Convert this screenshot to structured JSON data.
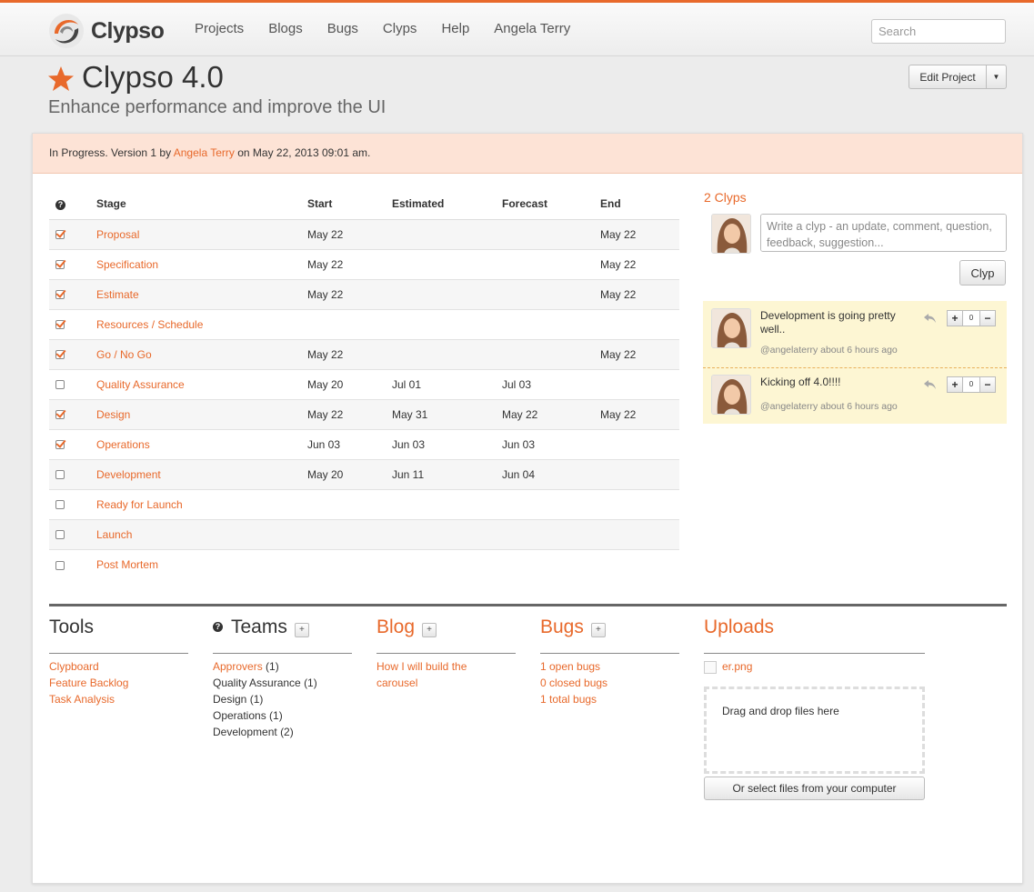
{
  "app": {
    "name": "Clypso"
  },
  "nav": {
    "items": [
      "Projects",
      "Blogs",
      "Bugs",
      "Clyps",
      "Help",
      "Angela Terry"
    ],
    "search_placeholder": "Search"
  },
  "project": {
    "title": "Clypso 4.0",
    "subtitle": "Enhance performance and improve the UI",
    "edit_label": "Edit Project"
  },
  "status": {
    "prefix": "In Progress. Version 1 by",
    "author": "Angela Terry",
    "suffix": "on May 22, 2013 09:01 am."
  },
  "stages": {
    "headers": [
      "Stage",
      "Start",
      "Estimated",
      "Forecast",
      "End"
    ],
    "rows": [
      {
        "done": true,
        "name": "Proposal",
        "start": "May 22",
        "estimated": "",
        "forecast": "",
        "end": "May 22"
      },
      {
        "done": true,
        "name": "Specification",
        "start": "May 22",
        "estimated": "",
        "forecast": "",
        "end": "May 22"
      },
      {
        "done": true,
        "name": "Estimate",
        "start": "May 22",
        "estimated": "",
        "forecast": "",
        "end": "May 22"
      },
      {
        "done": true,
        "name": "Resources / Schedule",
        "start": "",
        "estimated": "",
        "forecast": "",
        "end": ""
      },
      {
        "done": true,
        "name": "Go / No Go",
        "start": "May 22",
        "estimated": "",
        "forecast": "",
        "end": "May 22"
      },
      {
        "done": false,
        "name": "Quality Assurance",
        "start": "May 20",
        "estimated": "Jul 01",
        "forecast": "Jul 03",
        "end": ""
      },
      {
        "done": true,
        "name": "Design",
        "start": "May 22",
        "estimated": "May 31",
        "forecast": "May 22",
        "end": "May 22"
      },
      {
        "done": true,
        "name": "Operations",
        "start": "Jun 03",
        "estimated": "Jun 03",
        "forecast": "Jun 03",
        "end": ""
      },
      {
        "done": false,
        "name": "Development",
        "start": "May 20",
        "estimated": "Jun 11",
        "forecast": "Jun 04",
        "end": ""
      },
      {
        "done": false,
        "name": "Ready for Launch",
        "start": "",
        "estimated": "",
        "forecast": "",
        "end": ""
      },
      {
        "done": false,
        "name": "Launch",
        "start": "",
        "estimated": "",
        "forecast": "",
        "end": ""
      },
      {
        "done": false,
        "name": "Post Mortem",
        "start": "",
        "estimated": "",
        "forecast": "",
        "end": ""
      }
    ]
  },
  "clyps": {
    "title": "2 Clyps",
    "placeholder": "Write a clyp - an update, comment, question, feedback, suggestion...",
    "button": "Clyp",
    "items": [
      {
        "text": "Development is going pretty well..",
        "meta": "@angelaterry about 6 hours ago",
        "votes": "0"
      },
      {
        "text": "Kicking off 4.0!!!!",
        "meta": "@angelaterry about 6 hours ago",
        "votes": "0"
      }
    ]
  },
  "tools": {
    "title": "Tools",
    "items": [
      "Clypboard",
      "Feature Backlog",
      "Task Analysis"
    ]
  },
  "teams": {
    "title": "Teams",
    "items": [
      {
        "name": "Approvers",
        "count": "(1)"
      },
      {
        "name": "Quality Assurance",
        "count": "(1)"
      },
      {
        "name": "Design",
        "count": "(1)"
      },
      {
        "name": "Operations",
        "count": "(1)"
      },
      {
        "name": "Development",
        "count": "(2)"
      }
    ]
  },
  "blog": {
    "title": "Blog",
    "items": [
      "How I will build the carousel"
    ]
  },
  "bugs": {
    "title": "Bugs",
    "items": [
      "1 open bugs",
      "0 closed bugs",
      "1 total bugs"
    ]
  },
  "uploads": {
    "title": "Uploads",
    "file": "er.png",
    "dropzone": "Drag and drop files here",
    "select_button": "Or select files from your computer"
  },
  "colors": {
    "accent": "#e8692b",
    "status_bg": "#fde3d6",
    "feed_bg": "#fdf6d3"
  }
}
